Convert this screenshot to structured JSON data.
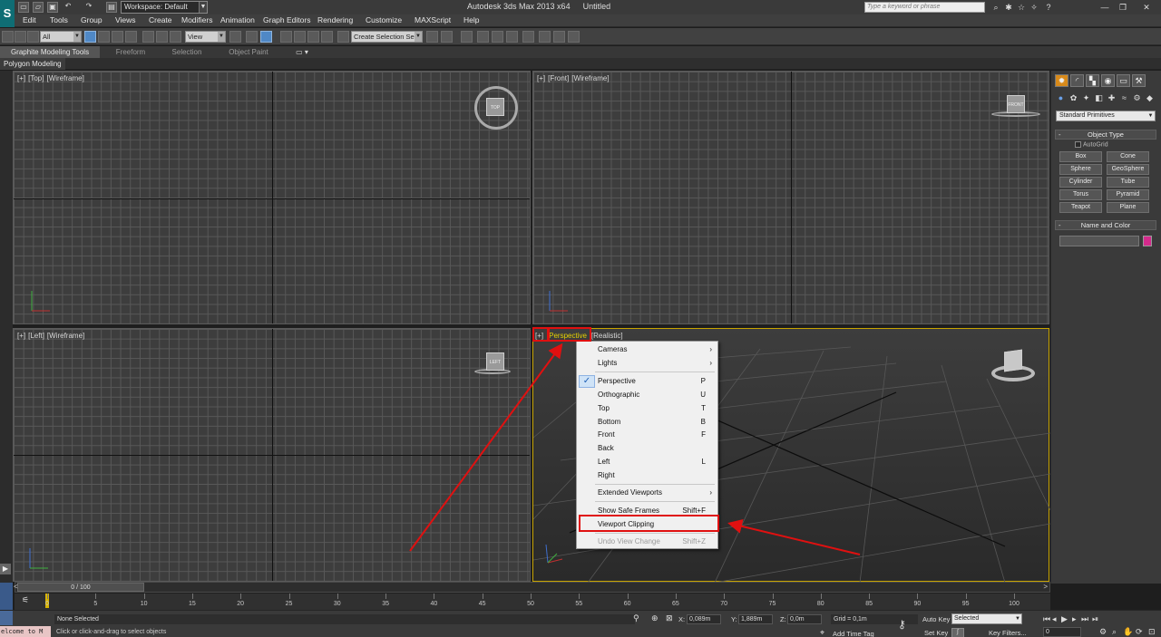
{
  "titlebar": {
    "logo": "S",
    "workspace": "Workspace: Default",
    "app_title": "Autodesk 3ds Max  2013 x64",
    "doc_title": "Untitled",
    "search_placeholder": "Type a keyword or phrase"
  },
  "menu": [
    "Edit",
    "Tools",
    "Group",
    "Views",
    "Create",
    "Modifiers",
    "Animation",
    "Graph Editors",
    "Rendering",
    "Customize",
    "MAXScript",
    "Help"
  ],
  "toolbar": {
    "filter": "All",
    "coord_system": "View",
    "selection_set": "Create Selection Se"
  },
  "ribbon": {
    "tabs": [
      "Graphite Modeling Tools",
      "Freeform",
      "Selection",
      "Object Paint"
    ],
    "subtab": "Polygon Modeling"
  },
  "viewports": {
    "top": {
      "plus": "[+]",
      "name": "[Top]",
      "shading": "[Wireframe]",
      "cube": "TOP"
    },
    "front": {
      "plus": "[+]",
      "name": "[Front]",
      "shading": "[Wireframe]",
      "cube": "FRONT"
    },
    "left": {
      "plus": "[+]",
      "name": "[Left]",
      "shading": "[Wireframe]",
      "cube": "LEFT"
    },
    "perspective": {
      "plus": "[+]",
      "name": "Perspective",
      "shading": "[Realistic]"
    }
  },
  "context_menu": {
    "cameras": "Cameras",
    "lights": "Lights",
    "perspective": "Perspective",
    "perspective_sc": "P",
    "orthographic": "Orthographic",
    "orthographic_sc": "U",
    "top": "Top",
    "top_sc": "T",
    "bottom": "Bottom",
    "bottom_sc": "B",
    "front": "Front",
    "front_sc": "F",
    "back": "Back",
    "left": "Left",
    "left_sc": "L",
    "right": "Right",
    "extended": "Extended Viewports",
    "safe_frames": "Show Safe Frames",
    "safe_frames_sc": "Shift+F",
    "clipping": "Viewport Clipping",
    "undo_view": "Undo View Change",
    "undo_view_sc": "Shift+Z"
  },
  "command_panel": {
    "category": "Standard Primitives",
    "object_type_title": "Object Type",
    "autogrid": "AutoGrid",
    "objects": [
      "Box",
      "Cone",
      "Sphere",
      "GeoSphere",
      "Cylinder",
      "Tube",
      "Torus",
      "Pyramid",
      "Teapot",
      "Plane"
    ],
    "name_color_title": "Name and Color",
    "rollout_sign": "-",
    "swatch_color": "#d42a8c"
  },
  "timeline": {
    "frame": "0 / 100",
    "ticks": [
      "0",
      "5",
      "10",
      "15",
      "20",
      "25",
      "30",
      "35",
      "40",
      "45",
      "50",
      "55",
      "60",
      "65",
      "70",
      "75",
      "80",
      "85",
      "90",
      "95",
      "100"
    ]
  },
  "status": {
    "listener": "elcome to M",
    "selection": "None Selected",
    "prompt": "Click or click-and-drag to select objects",
    "x_label": "X:",
    "x_value": "0,089m",
    "y_label": "Y:",
    "y_value": "1,889m",
    "z_label": "Z:",
    "z_value": "0,0m",
    "grid": "Grid = 0,1m",
    "add_time_tag": "Add Time Tag",
    "auto_key": "Auto Key",
    "set_key": "Set Key",
    "key_mode": "Selected",
    "key_filters": "Key Filters...",
    "current_frame": "0"
  },
  "colors": {
    "highlight": "#e01010",
    "active_viewport": "#c8a400",
    "perspective_label": "#e8d000"
  }
}
